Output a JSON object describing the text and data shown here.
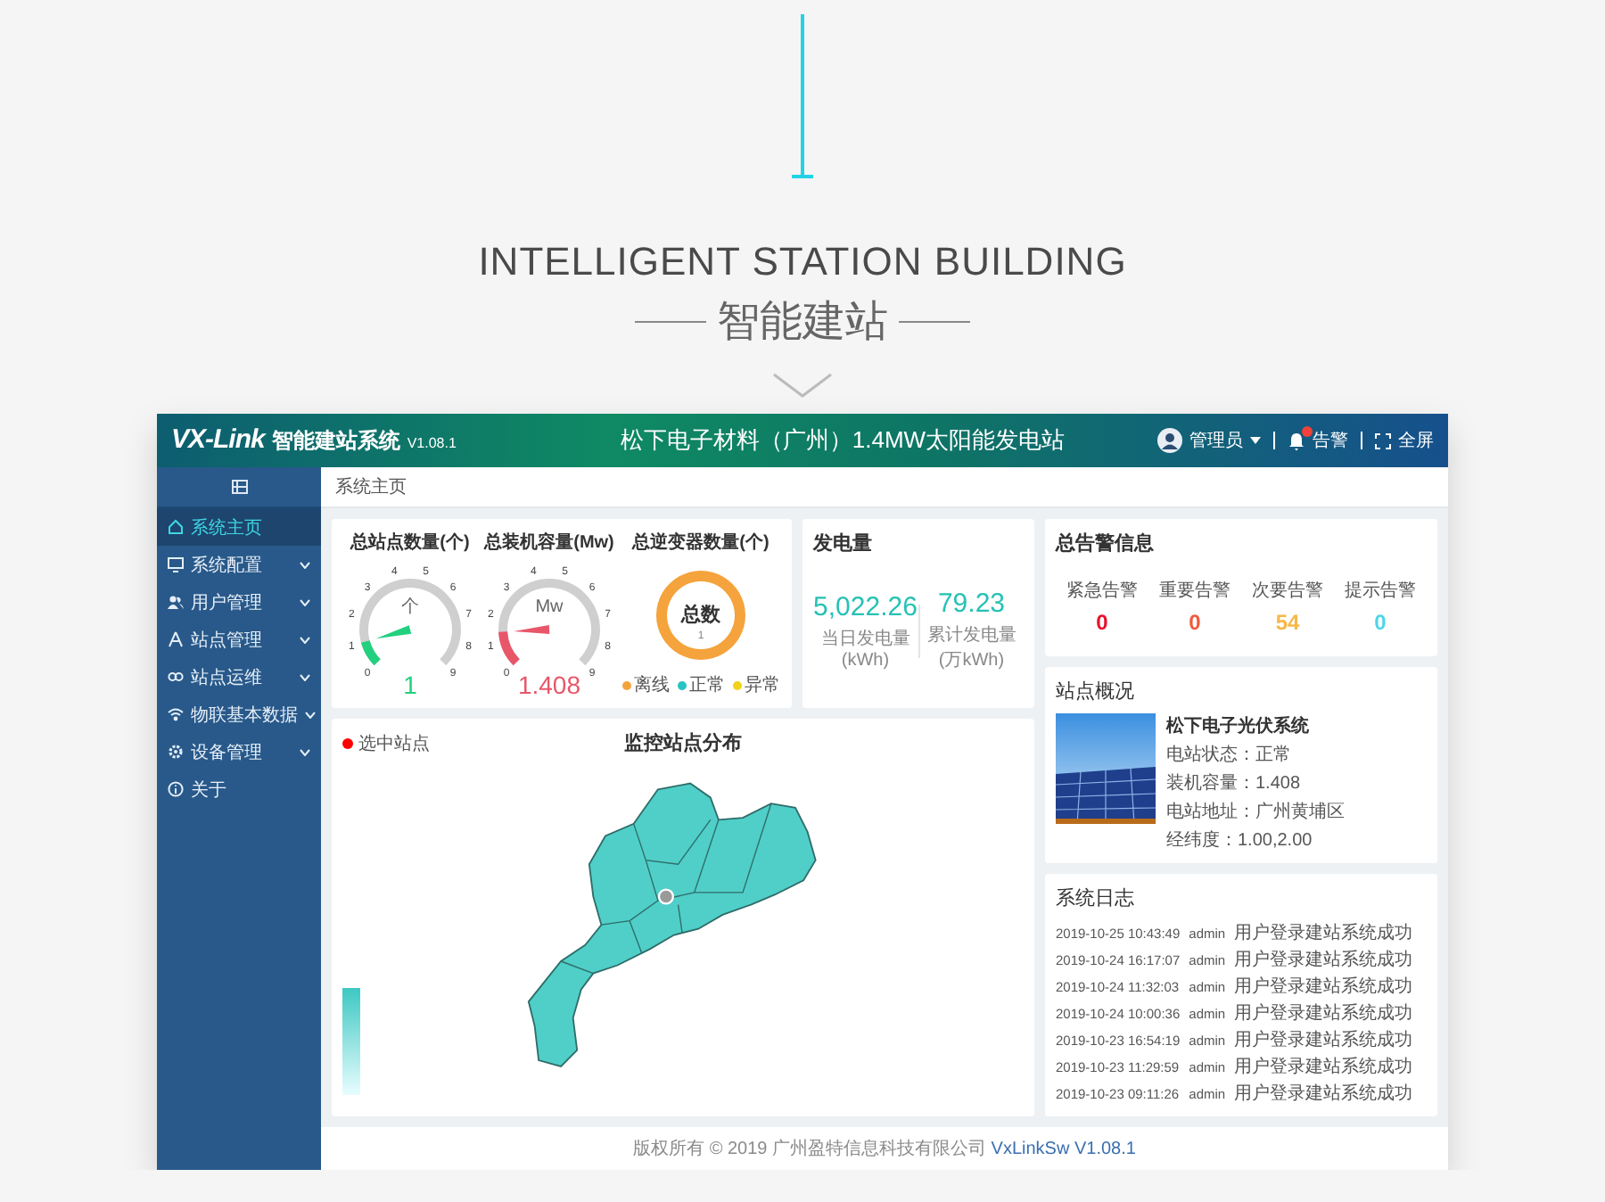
{
  "intro": {
    "title": "INTELLIGENT STATION BUILDING",
    "subtitle": "智能建站"
  },
  "header": {
    "brand": "VX-Link",
    "system_name": "智能建站系统",
    "version": "V1.08.1",
    "station_title": "松下电子材料（广州）1.4MW太阳能发电站",
    "user": "管理员",
    "alarm": "告警",
    "fullscreen": "全屏"
  },
  "sidebar": {
    "items": [
      {
        "label": "系统主页",
        "kind": "home",
        "selected": true,
        "expandable": false
      },
      {
        "label": "系统配置",
        "kind": "config",
        "selected": false,
        "expandable": true
      },
      {
        "label": "用户管理",
        "kind": "users",
        "selected": false,
        "expandable": true
      },
      {
        "label": "站点管理",
        "kind": "station",
        "selected": false,
        "expandable": true
      },
      {
        "label": "站点运维",
        "kind": "maintenance",
        "selected": false,
        "expandable": true
      },
      {
        "label": "物联基本数据",
        "kind": "iot",
        "selected": false,
        "expandable": true
      },
      {
        "label": "设备管理",
        "kind": "device",
        "selected": false,
        "expandable": true
      },
      {
        "label": "关于",
        "kind": "about",
        "selected": false,
        "expandable": false
      }
    ]
  },
  "breadcrumb": "系统主页",
  "gauges": [
    {
      "title": "总站点数量(个)",
      "unit": "个",
      "ticks": [
        "0",
        "1",
        "2",
        "3",
        "4",
        "5",
        "6",
        "7",
        "8",
        "9"
      ],
      "level": 0.111,
      "value": "1",
      "color": "#22d07e"
    },
    {
      "title": "总装机容量(Mw)",
      "unit": "Mw",
      "ticks": [
        "0",
        "1",
        "2",
        "3",
        "4",
        "5",
        "6",
        "7",
        "8",
        "9"
      ],
      "level": 0.156,
      "value": "1.408",
      "color": "#e8566a"
    }
  ],
  "inverters": {
    "title": "总逆变器数量(个)",
    "center_label": "总数",
    "total": "1",
    "legend": [
      {
        "label": "离线",
        "color": "#f5a33c"
      },
      {
        "label": "正常",
        "color": "#27c2c4"
      },
      {
        "label": "异常",
        "color": "#f2d21b"
      }
    ]
  },
  "generation": {
    "title": "发电量",
    "stats": [
      {
        "value": "5,022.26",
        "label": "当日发电量(kWh)"
      },
      {
        "value": "79.23",
        "label": "累计发电量(万kWh)"
      }
    ]
  },
  "alarms": {
    "title": "总告警信息",
    "items": [
      {
        "label": "紧急告警",
        "count": "0",
        "color": "#e8112d"
      },
      {
        "label": "重要告警",
        "count": "0",
        "color": "#f05a3c"
      },
      {
        "label": "次要告警",
        "count": "54",
        "color": "#f5b84a"
      },
      {
        "label": "提示告警",
        "count": "0",
        "color": "#4fd6e8"
      }
    ]
  },
  "map": {
    "title": "监控站点分布",
    "legend": "选中站点"
  },
  "station": {
    "title": "站点概况",
    "name": "松下电子光伏系统",
    "fields": [
      "电站状态：正常",
      "装机容量：1.408",
      "电站地址：广州黄埔区",
      "经纬度：1.00,2.00"
    ]
  },
  "log": {
    "title": "系统日志",
    "rows": [
      {
        "time": "2019-10-25 10:43:49",
        "user": "admin",
        "message": "用户登录建站系统成功"
      },
      {
        "time": "2019-10-24 16:17:07",
        "user": "admin",
        "message": "用户登录建站系统成功"
      },
      {
        "time": "2019-10-24 11:32:03",
        "user": "admin",
        "message": "用户登录建站系统成功"
      },
      {
        "time": "2019-10-24 10:00:36",
        "user": "admin",
        "message": "用户登录建站系统成功"
      },
      {
        "time": "2019-10-23 16:54:19",
        "user": "admin",
        "message": "用户登录建站系统成功"
      },
      {
        "time": "2019-10-23 11:29:59",
        "user": "admin",
        "message": "用户登录建站系统成功"
      },
      {
        "time": "2019-10-23 09:11:26",
        "user": "admin",
        "message": "用户登录建站系统成功"
      }
    ]
  },
  "footer": {
    "copyright": "版权所有 © 2019 广州盈特信息科技有限公司",
    "product": "VxLinkSw V1.08.1"
  }
}
